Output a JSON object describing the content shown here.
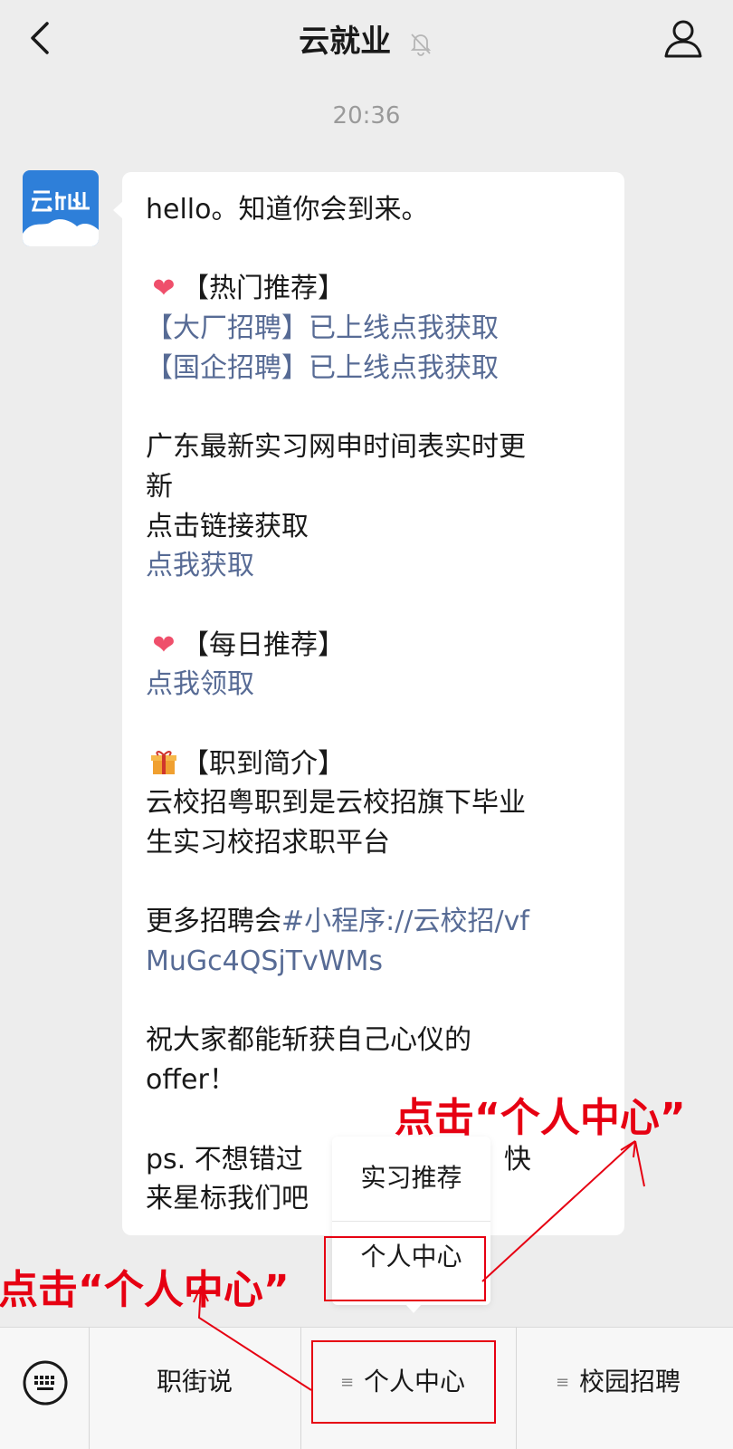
{
  "header": {
    "title": "云就业"
  },
  "time": "20:36",
  "message": {
    "lines": [
      [
        {
          "t": "hello。知道你会到来。"
        }
      ],
      [],
      [
        {
          "icon": "heart"
        },
        {
          "t": "【热门推荐】"
        }
      ],
      [
        {
          "t": "【大厂招聘】已上线点我获取",
          "link": true
        }
      ],
      [
        {
          "t": "【国企招聘】已上线点我获取",
          "link": true
        }
      ],
      [],
      [
        {
          "t": "广东最新实习网申时间表实时更"
        }
      ],
      [
        {
          "t": "新"
        }
      ],
      [
        {
          "t": "点击链接获取"
        }
      ],
      [
        {
          "t": "点我获取",
          "link": true
        }
      ],
      [],
      [
        {
          "icon": "heart"
        },
        {
          "t": "【每日推荐】"
        }
      ],
      [
        {
          "t": "点我领取",
          "link": true
        }
      ],
      [],
      [
        {
          "icon": "gift"
        },
        {
          "t": "【职到简介】"
        }
      ],
      [
        {
          "t": "云校招粤职到是云校招旗下毕业"
        }
      ],
      [
        {
          "t": "生实习校招求职平台"
        }
      ],
      [],
      [
        {
          "t": "更多招聘会"
        },
        {
          "t": "#小程序://云校招/vf",
          "link": true
        }
      ],
      [
        {
          "t": "MuGc4QSjTvWMs",
          "link": true
        }
      ],
      [],
      [
        {
          "t": "祝大家都能斩获自己心仪的"
        }
      ],
      [
        {
          "t": "offer！"
        }
      ],
      [],
      [
        {
          "t": "ps. 不想错过"
        },
        {
          "t": "                 "
        },
        {
          "t": "会，快"
        }
      ],
      [
        {
          "t": "来星标我们吧"
        }
      ]
    ]
  },
  "popup": {
    "items": [
      "实习推荐",
      "个人中心"
    ]
  },
  "tabbar": {
    "tabs": [
      "职街说",
      "个人中心",
      "校园招聘"
    ]
  },
  "annotations": {
    "top_text": "点击“个人中心”",
    "bottom_text": "点击“个人中心”"
  },
  "colors": {
    "annotation": "#e60012",
    "link": "#576b95",
    "avatar_bg": "#2e7fd9"
  }
}
